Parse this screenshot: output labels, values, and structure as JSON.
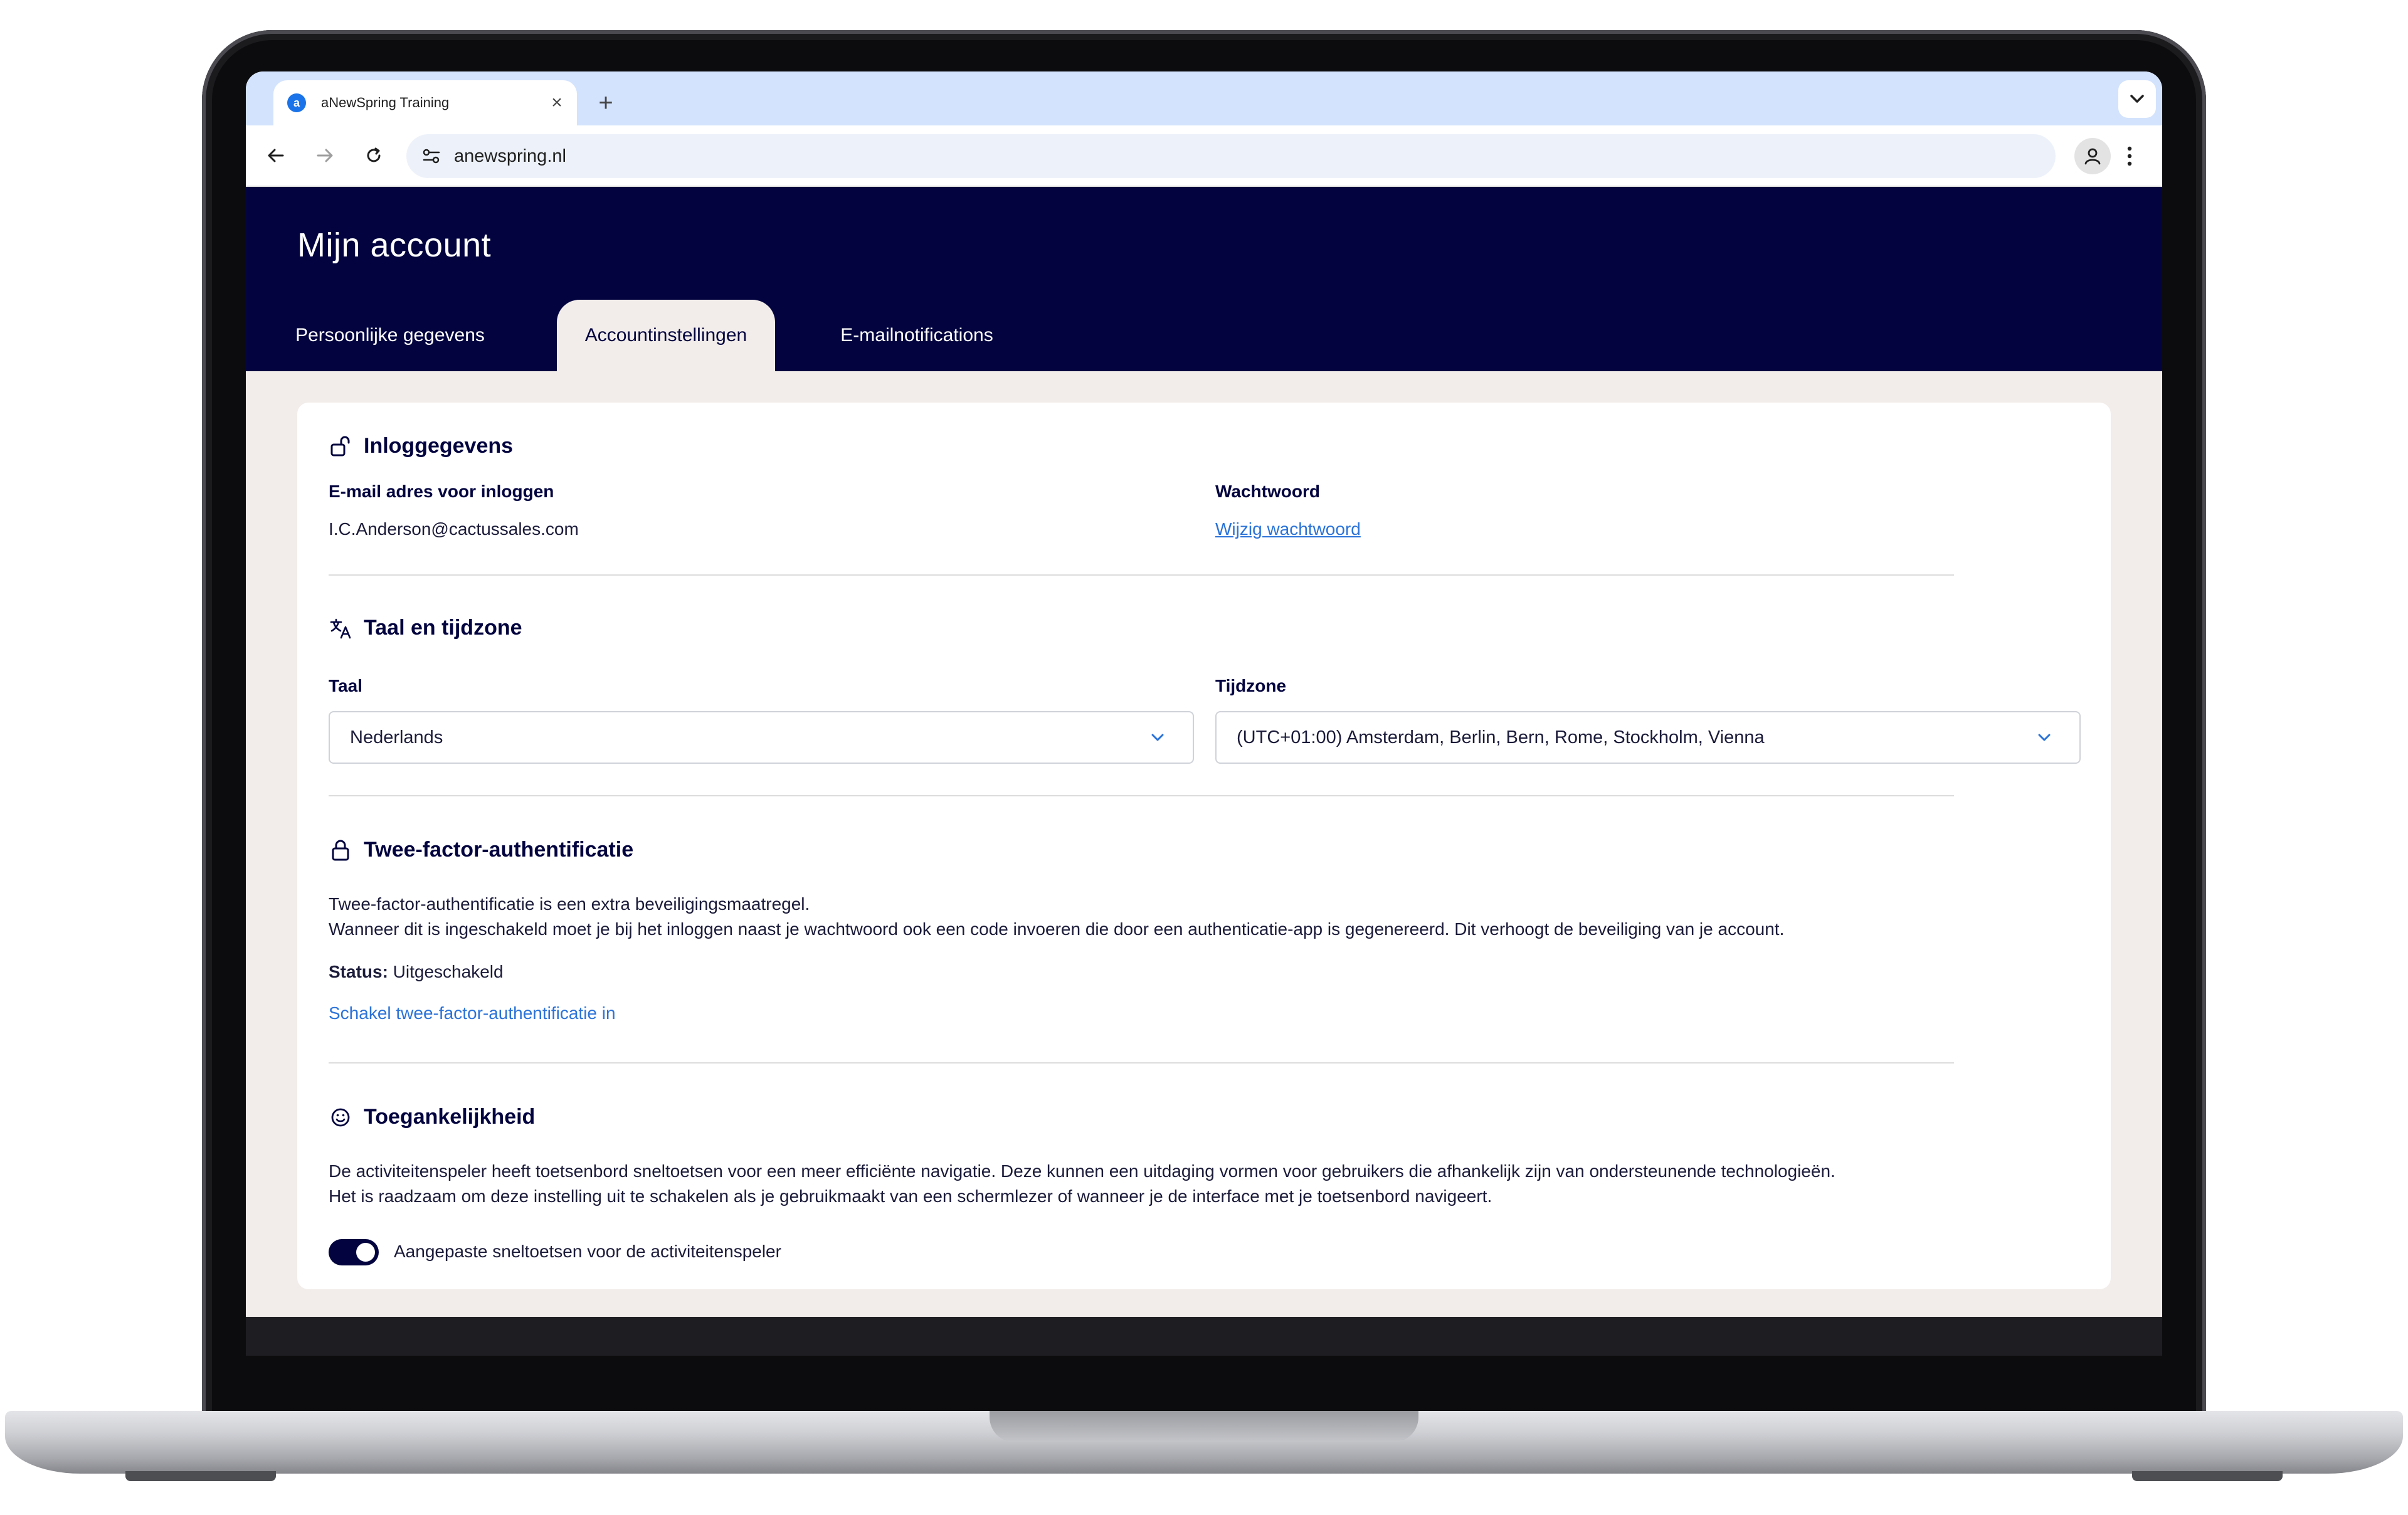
{
  "browser": {
    "tab_title": "aNewSpring Training",
    "new_tab_symbol": "+",
    "close_symbol": "×",
    "favicon_letter": "a",
    "url": "anewspring.nl"
  },
  "page": {
    "title": "Mijn account",
    "tabs": [
      {
        "label": "Persoonlijke gegevens",
        "active": false
      },
      {
        "label": "Accountinstellingen",
        "active": true
      },
      {
        "label": "E-mailnotifications",
        "active": false
      }
    ]
  },
  "login": {
    "title": "Inloggegevens",
    "email_label": "E-mail adres voor inloggen",
    "email_value": "I.C.Anderson@cactussales.com",
    "password_label": "Wachtwoord",
    "password_link": "Wijzig wachtwoord"
  },
  "language": {
    "title": "Taal en tijdzone",
    "language_label": "Taal",
    "language_value": "Nederlands",
    "timezone_label": "Tijdzone",
    "timezone_value": "(UTC+01:00) Amsterdam, Berlin, Bern, Rome, Stockholm, Vienna"
  },
  "twofactor": {
    "title": "Twee-factor-authentificatie",
    "line1": "Twee-factor-authentificatie is een extra beveiligingsmaatregel.",
    "line2": "Wanneer dit is ingeschakeld moet je bij het inloggen naast je wachtwoord ook een code invoeren die door een authenticatie-app is gegenereerd. Dit verhoogt de beveiliging van je account.",
    "status_label": "Status:",
    "status_value": " Uitgeschakeld",
    "enable_link": "Schakel twee-factor-authentificatie in"
  },
  "accessibility": {
    "title": "Toegankelijkheid",
    "line1": "De activiteitenspeler heeft toetsenbord sneltoetsen voor een meer efficiënte navigatie. Deze kunnen een uitdaging vormen voor gebruikers die afhankelijk zijn van ondersteunende technologieën.",
    "line2": "Het is raadzaam om deze instelling uit te schakelen als je gebruikmaakt van een schermlezer of wanneer je de interface met je toetsenbord navigeert.",
    "toggle_label": "Aangepaste sneltoetsen voor de activiteitenspeler",
    "toggle_on": true
  },
  "colors": {
    "header_bg": "#03043f",
    "page_bg": "#f2edea",
    "link": "#2b73d9",
    "tabstrip": "#d3e3fd"
  }
}
